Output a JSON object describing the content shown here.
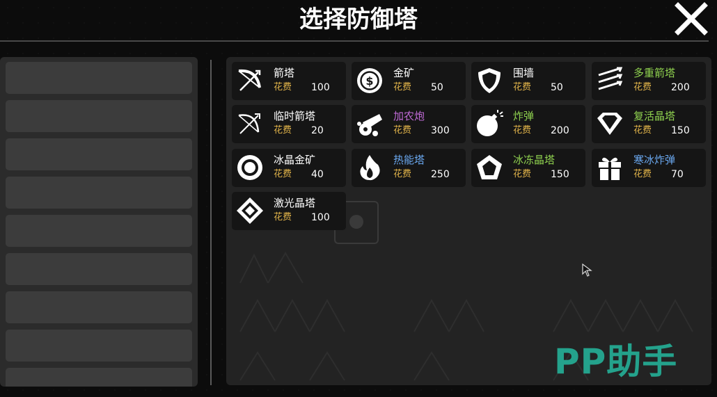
{
  "header": {
    "title": "选择防御塔"
  },
  "cost_label": "花费",
  "towers": [
    {
      "name": "箭塔",
      "cost": "100",
      "color": "#ffffff",
      "icon": "bow-icon"
    },
    {
      "name": "金矿",
      "cost": "50",
      "color": "#ffffff",
      "icon": "coin-icon"
    },
    {
      "name": "围墙",
      "cost": "50",
      "color": "#ffffff",
      "icon": "shield-icon"
    },
    {
      "name": "多重箭塔",
      "cost": "200",
      "color": "#8fd14f",
      "icon": "multi-arrow-icon"
    },
    {
      "name": "临时箭塔",
      "cost": "20",
      "color": "#ffffff",
      "icon": "bow-outline-icon"
    },
    {
      "name": "加农炮",
      "cost": "300",
      "color": "#c06ad6",
      "icon": "cannon-icon"
    },
    {
      "name": "炸弹",
      "cost": "200",
      "color": "#8fd14f",
      "icon": "bomb-icon"
    },
    {
      "name": "复活晶塔",
      "cost": "150",
      "color": "#8fd14f",
      "icon": "gem-icon"
    },
    {
      "name": "冰晶金矿",
      "cost": "40",
      "color": "#ffffff",
      "icon": "ring-icon"
    },
    {
      "name": "热能塔",
      "cost": "250",
      "color": "#6aa8f0",
      "icon": "flame-icon"
    },
    {
      "name": "冰冻晶塔",
      "cost": "150",
      "color": "#8fd14f",
      "icon": "pentagon-icon"
    },
    {
      "name": "寒冰炸弹",
      "cost": "70",
      "color": "#6aa8f0",
      "icon": "gift-icon"
    },
    {
      "name": "激光晶塔",
      "cost": "100",
      "color": "#ffffff",
      "icon": "diamond-icon"
    }
  ],
  "slots_count": 9,
  "watermark": "PP助手"
}
